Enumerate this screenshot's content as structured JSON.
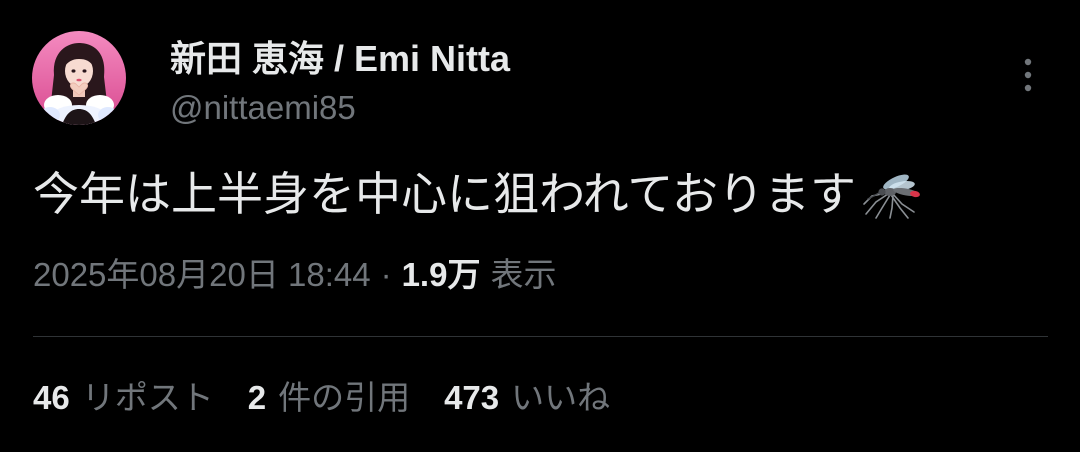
{
  "author": {
    "display_name": "新田 恵海 / Emi Nitta",
    "handle": "@nittaemi85",
    "avatar_icon": "profile-photo"
  },
  "more_icon": "more-vertical-icon",
  "tweet": {
    "text": "今年は上半身を中心に狙われております",
    "emoji_icon": "mosquito"
  },
  "meta": {
    "timestamp": "2025年08月20日 18:44",
    "separator": "·",
    "views_count": "1.9万",
    "views_label": "表示"
  },
  "stats": {
    "reposts_count": "46",
    "reposts_label": "リポスト",
    "quotes_count": "2",
    "quotes_label": "件の引用",
    "likes_count": "473",
    "likes_label": "いいね"
  },
  "colors": {
    "background": "#000000",
    "text_primary": "#e7e9ea",
    "text_secondary": "#71767b",
    "divider": "#2f3336"
  }
}
